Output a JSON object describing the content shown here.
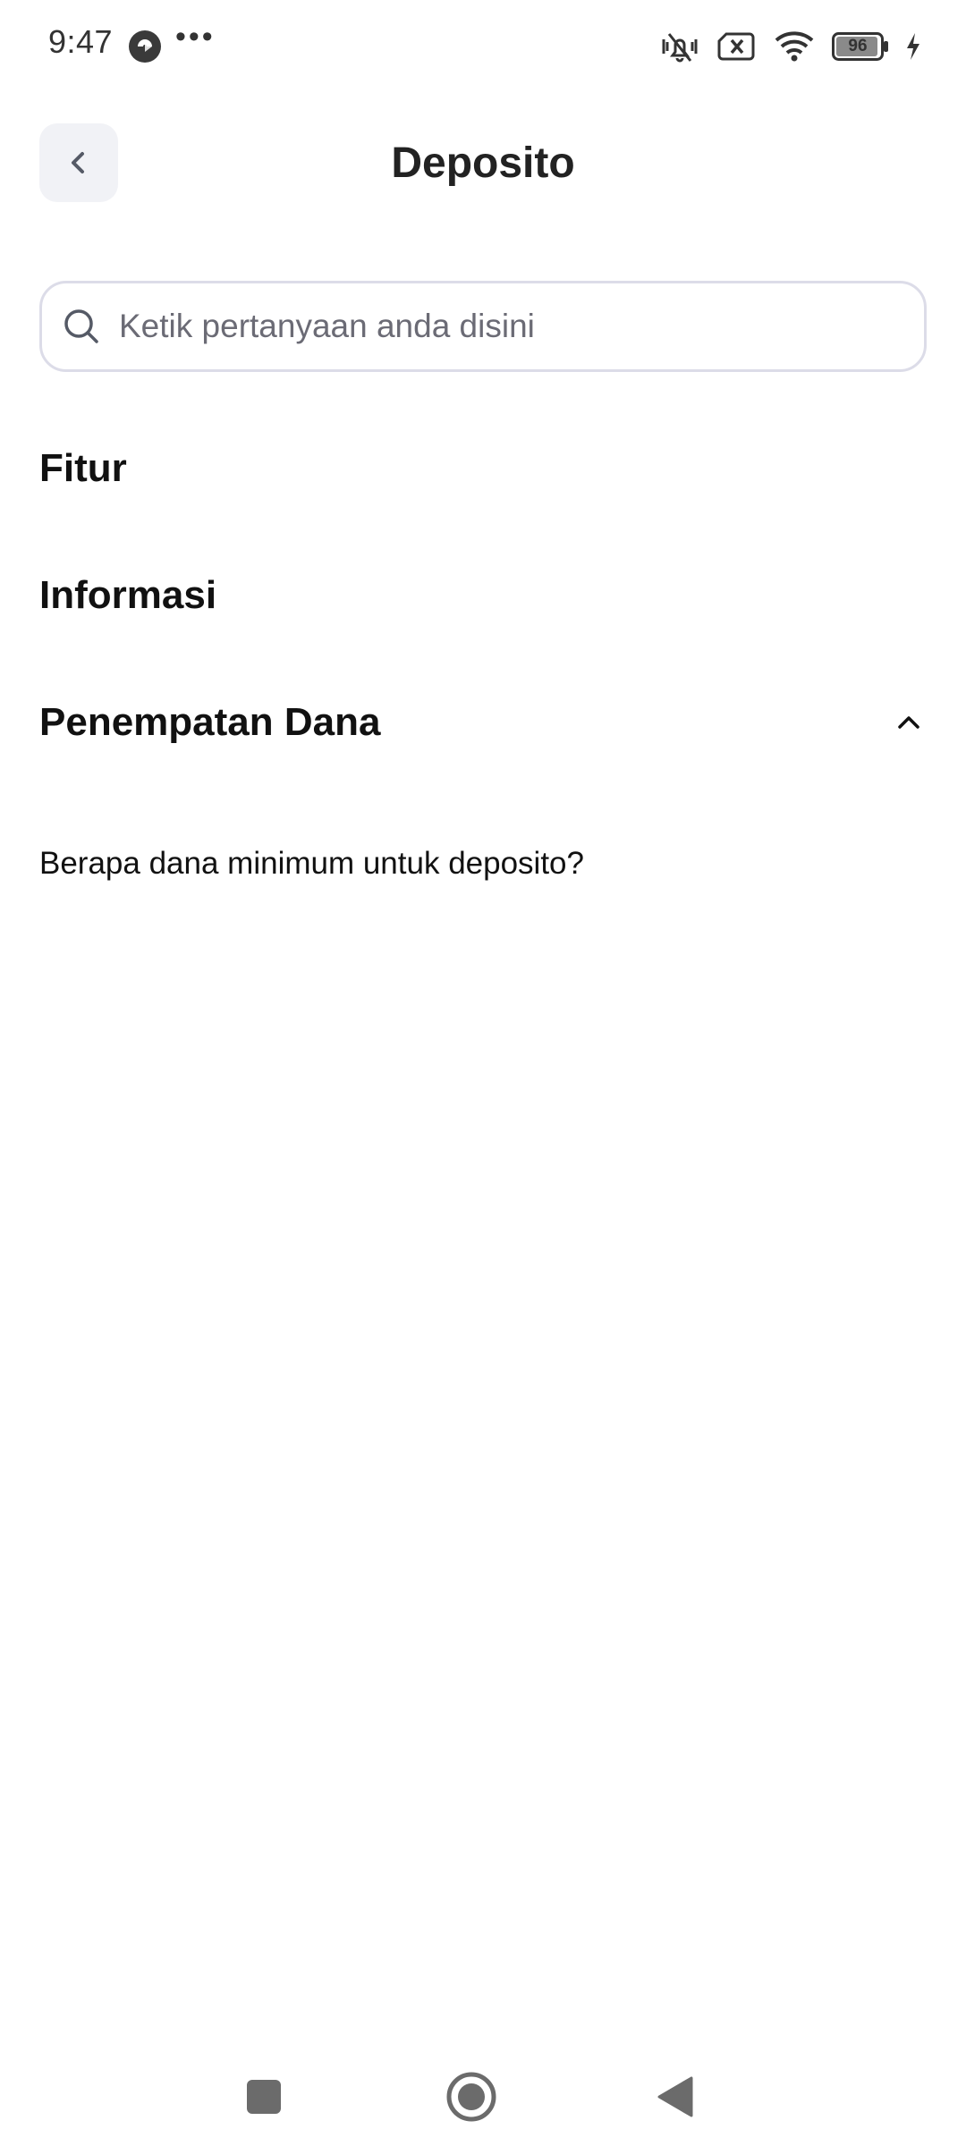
{
  "status_bar": {
    "time": "9:47",
    "more": "•••",
    "battery_level": "96",
    "icons": [
      "app-icon",
      "vibrate-mute-icon",
      "sim-off-icon",
      "wifi-icon",
      "battery-icon",
      "charging-icon"
    ]
  },
  "header": {
    "title": "Deposito",
    "back_icon": "chevron-left-icon"
  },
  "search": {
    "placeholder": "Ketik pertanyaan anda disini",
    "value": ""
  },
  "sections": [
    {
      "title": "Fitur",
      "expanded": false
    },
    {
      "title": "Informasi",
      "expanded": false
    },
    {
      "title": "Penempatan Dana",
      "expanded": true,
      "questions": [
        "Berapa dana minimum untuk deposito?"
      ]
    }
  ],
  "nav_bar": {
    "buttons": [
      "recents-button",
      "home-button",
      "back-button"
    ]
  },
  "colors": {
    "background": "#ffffff",
    "text_primary": "#111111",
    "back_button_bg": "#f1f2f6",
    "search_border": "#dcdce8",
    "placeholder": "#6b6b75"
  }
}
